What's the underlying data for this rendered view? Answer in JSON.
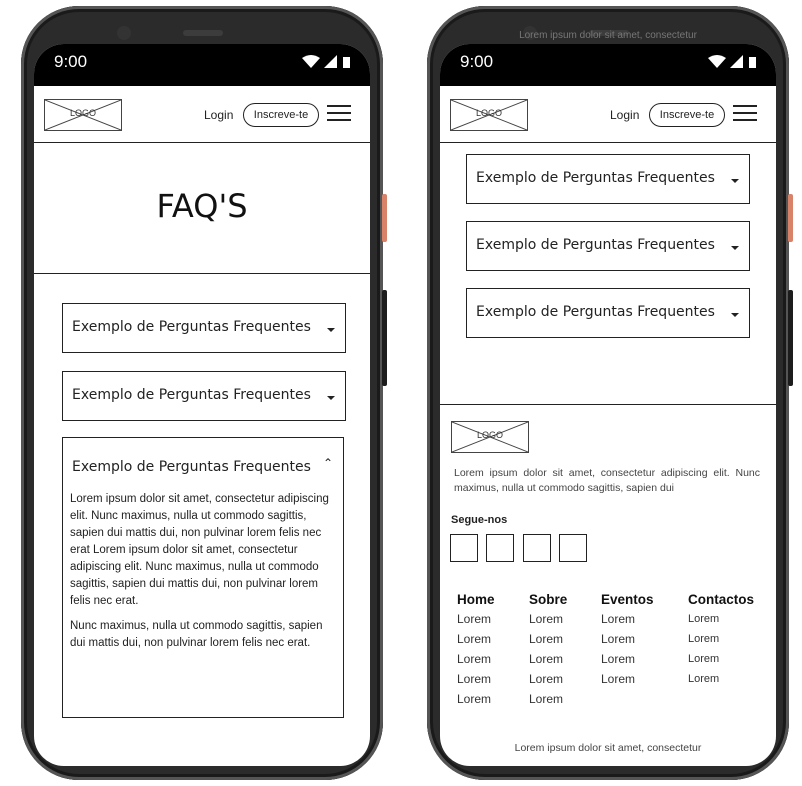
{
  "status": {
    "time": "9:00"
  },
  "header": {
    "logo_label": "LOGO",
    "login_label": "Login",
    "signup_label": "Inscreve-te"
  },
  "faq": {
    "title": "FAQ'S",
    "questions": [
      "Exemplo de Perguntas Frequentes",
      "Exemplo de Perguntas Frequentes",
      "Exemplo de Perguntas Frequentes"
    ],
    "expanded_answer": [
      "Lorem ipsum dolor sit amet, consectetur adipiscing elit. Nunc maximus, nulla ut commodo sagittis, sapien dui mattis dui, non pulvinar lorem felis nec erat Lorem ipsum dolor sit amet, consectetur adipiscing elit. Nunc maximus, nulla ut commodo sagittis, sapien dui mattis dui, non pulvinar lorem felis nec erat.",
      "Nunc maximus, nulla ut commodo sagittis, sapien dui mattis dui, non pulvinar lorem felis nec erat."
    ]
  },
  "right_screen": {
    "ghost_text": "Lorem ipsum dolor sit amet, consectetur",
    "questions": [
      "Exemplo de Perguntas Frequentes",
      "Exemplo de Perguntas Frequentes",
      "Exemplo de Perguntas Frequentes"
    ]
  },
  "footer": {
    "logo_label": "LOGO",
    "description": "Lorem ipsum dolor sit amet, consectetur adipiscing elit. Nunc maximus, nulla ut commodo sagittis, sapien dui",
    "follow_label": "Segue-nos",
    "columns": [
      {
        "title": "Home",
        "items": [
          "Lorem",
          "Lorem",
          "Lorem",
          "Lorem",
          "Lorem"
        ]
      },
      {
        "title": "Sobre",
        "items": [
          "Lorem",
          "Lorem",
          "Lorem",
          "Lorem",
          "Lorem"
        ]
      },
      {
        "title": "Eventos",
        "items": [
          "Lorem",
          "Lorem",
          "Lorem",
          "Lorem"
        ]
      },
      {
        "title": "Contactos",
        "items": [
          "Lorem",
          "Lorem",
          "Lorem",
          "Lorem"
        ]
      }
    ],
    "bottom_note": "Lorem ipsum dolor sit amet, consectetur"
  },
  "colors": {
    "frame": "#2b2b2b",
    "accent_button": "#d9826a",
    "ink": "#222222"
  }
}
